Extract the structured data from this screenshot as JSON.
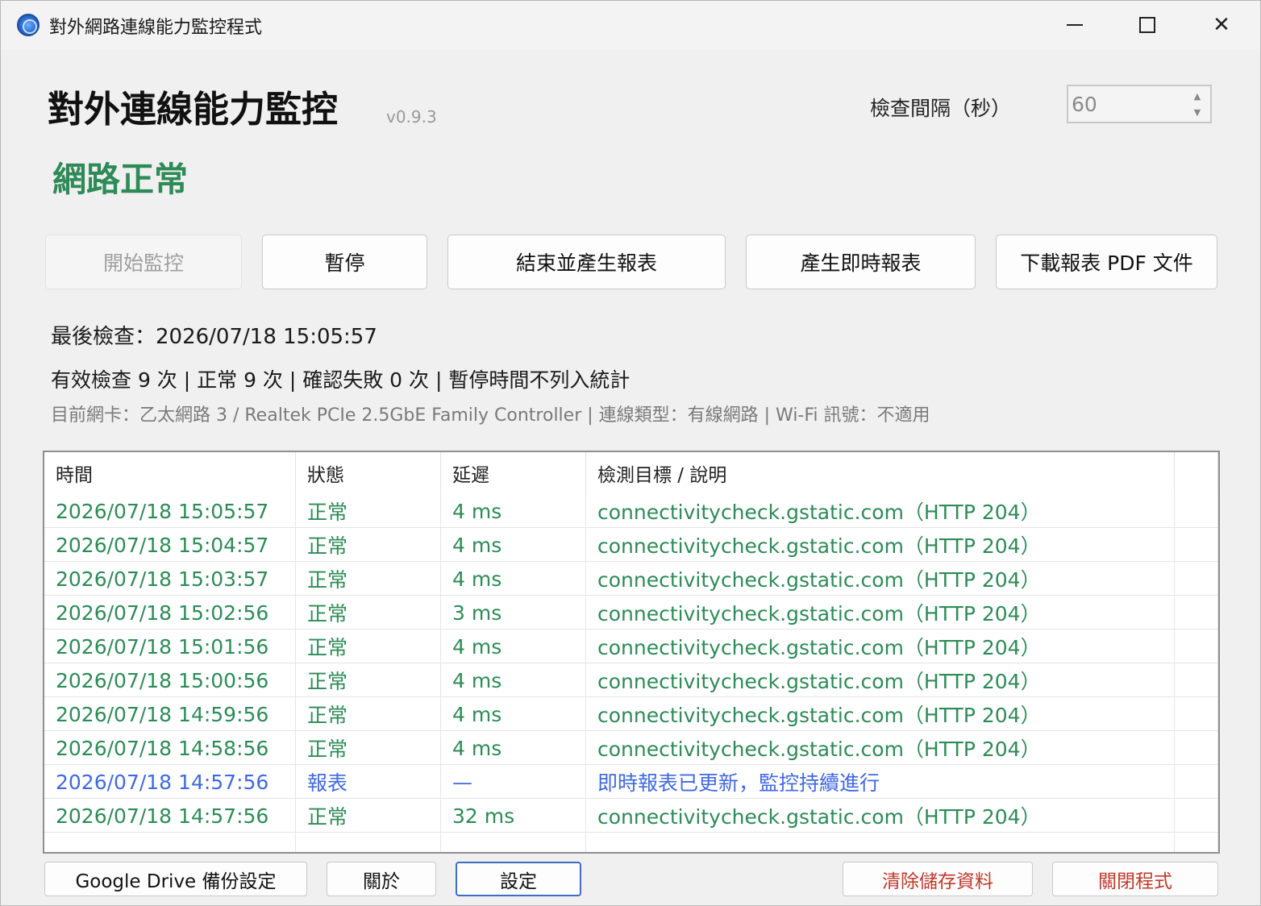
{
  "window": {
    "title": "對外網路連線能力監控程式"
  },
  "header": {
    "app_title": "對外連線能力監控",
    "version": "v0.9.3",
    "interval_label": "檢查間隔（秒）",
    "interval_value": "60",
    "status": "網路正常",
    "status_color": "#2e8b57"
  },
  "actions": {
    "start": "開始監控",
    "pause": "暫停",
    "end_report": "結束並產生報表",
    "instant_report": "產生即時報表",
    "download_pdf": "下載報表 PDF 文件"
  },
  "info": {
    "last_check": "最後檢查：2026/07/18 15:05:57",
    "stats": "有效檢查 9 次 | 正常 9 次 | 確認失敗 0 次 | 暫停時間不列入統計",
    "nic": "目前網卡：乙太網路 3 / Realtek PCIe 2.5GbE Family Controller | 連線類型：有線網路 | Wi-Fi 訊號：不適用"
  },
  "table": {
    "columns": [
      "時間",
      "狀態",
      "延遲",
      "檢測目標 / 說明"
    ],
    "rows": [
      {
        "time": "2026/07/18 15:05:57",
        "status": "正常",
        "delay": "4 ms",
        "target": "connectivitycheck.gstatic.com（HTTP 204）",
        "kind": "ok"
      },
      {
        "time": "2026/07/18 15:04:57",
        "status": "正常",
        "delay": "4 ms",
        "target": "connectivitycheck.gstatic.com（HTTP 204）",
        "kind": "ok"
      },
      {
        "time": "2026/07/18 15:03:57",
        "status": "正常",
        "delay": "4 ms",
        "target": "connectivitycheck.gstatic.com（HTTP 204）",
        "kind": "ok"
      },
      {
        "time": "2026/07/18 15:02:56",
        "status": "正常",
        "delay": "3 ms",
        "target": "connectivitycheck.gstatic.com（HTTP 204）",
        "kind": "ok"
      },
      {
        "time": "2026/07/18 15:01:56",
        "status": "正常",
        "delay": "4 ms",
        "target": "connectivitycheck.gstatic.com（HTTP 204）",
        "kind": "ok"
      },
      {
        "time": "2026/07/18 15:00:56",
        "status": "正常",
        "delay": "4 ms",
        "target": "connectivitycheck.gstatic.com（HTTP 204）",
        "kind": "ok"
      },
      {
        "time": "2026/07/18 14:59:56",
        "status": "正常",
        "delay": "4 ms",
        "target": "connectivitycheck.gstatic.com（HTTP 204）",
        "kind": "ok"
      },
      {
        "time": "2026/07/18 14:58:56",
        "status": "正常",
        "delay": "4 ms",
        "target": "connectivitycheck.gstatic.com（HTTP 204）",
        "kind": "ok"
      },
      {
        "time": "2026/07/18 14:57:56",
        "status": "報表",
        "delay": "—",
        "target": "即時報表已更新，監控持續進行",
        "kind": "rep"
      },
      {
        "time": "2026/07/18 14:57:56",
        "status": "正常",
        "delay": "32 ms",
        "target": "connectivitycheck.gstatic.com（HTTP 204）",
        "kind": "ok"
      }
    ]
  },
  "footer": {
    "gdrive": "Google Drive 備份設定",
    "about": "關於",
    "settings": "設定",
    "clear": "清除儲存資料",
    "close": "關閉程式"
  },
  "colors": {
    "ok": "#2e8b57",
    "report": "#4169e1",
    "danger": "#c0392b"
  }
}
